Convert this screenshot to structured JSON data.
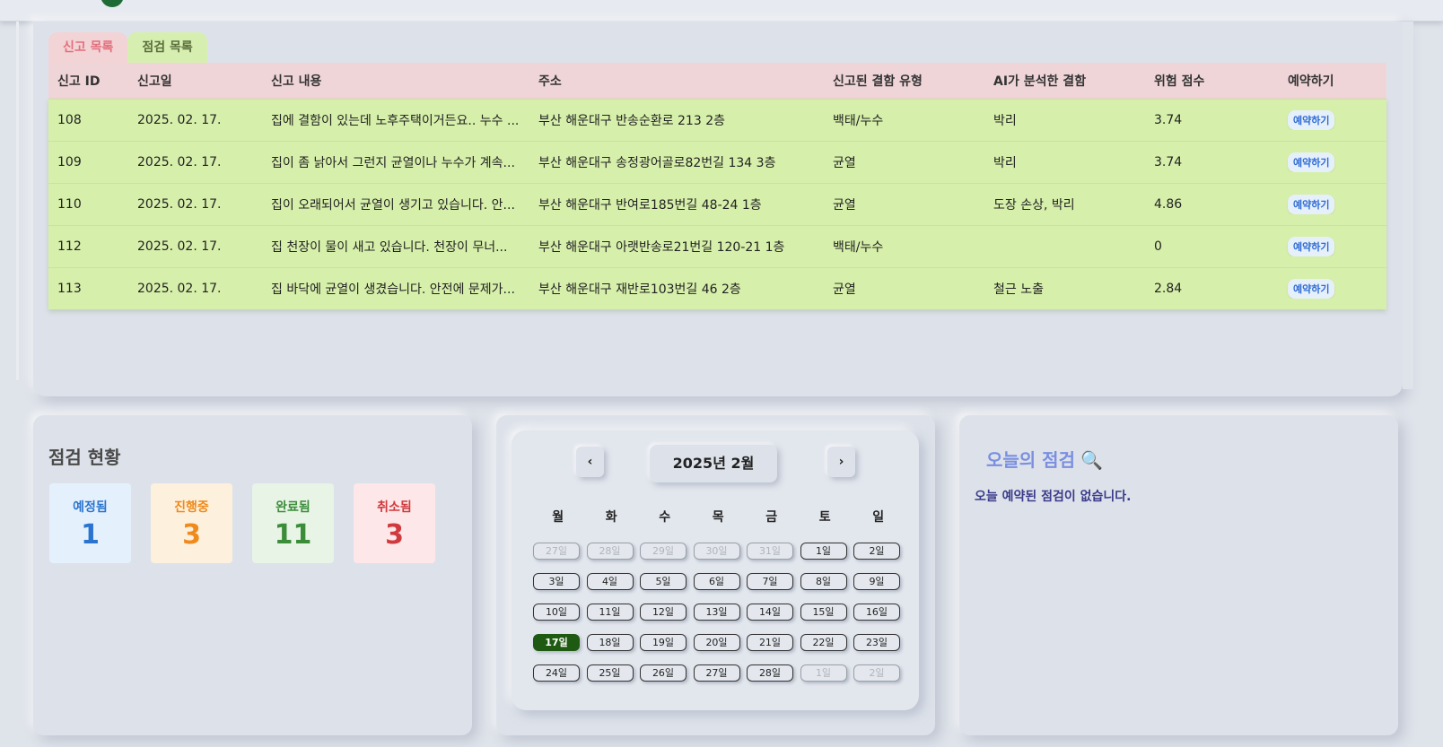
{
  "tabs": {
    "report_label": "신고 목록",
    "inspect_label": "점검 목록"
  },
  "table": {
    "headers": [
      "신고 ID",
      "신고일",
      "신고 내용",
      "주소",
      "신고된 결함 유형",
      "AI가 분석한 결함",
      "위험 점수",
      "예약하기"
    ],
    "rows": [
      {
        "id": "108",
        "date": "2025. 02. 17.",
        "content": "집에 결함이 있는데 노후주택이거든요.. 누수 ...",
        "address": "부산 해운대구 반송순환로 213 2층",
        "reported_type": "백태/누수",
        "ai_defect": "박리",
        "risk": "3.74",
        "action": "예약하기"
      },
      {
        "id": "109",
        "date": "2025. 02. 17.",
        "content": "집이 좀 낡아서 그런지 균열이나 누수가 계속...",
        "address": "부산 해운대구 송정광어골로82번길 134 3층",
        "reported_type": "균열",
        "ai_defect": "박리",
        "risk": "3.74",
        "action": "예약하기"
      },
      {
        "id": "110",
        "date": "2025. 02. 17.",
        "content": "집이 오래되어서 균열이 생기고 있습니다. 안...",
        "address": "부산 해운대구 반여로185번길 48-24 1층",
        "reported_type": "균열",
        "ai_defect": "도장 손상, 박리",
        "risk": "4.86",
        "action": "예약하기"
      },
      {
        "id": "112",
        "date": "2025. 02. 17.",
        "content": "집 천장이 물이 새고 있습니다. 천장이 무너...",
        "address": "부산 해운대구 아랫반송로21번길 120-21 1층",
        "reported_type": "백태/누수",
        "ai_defect": "",
        "risk": "0",
        "action": "예약하기"
      },
      {
        "id": "113",
        "date": "2025. 02. 17.",
        "content": "집 바닥에 균열이 생겼습니다. 안전에 문제가...",
        "address": "부산 해운대구 재반로103번길 46 2층",
        "reported_type": "균열",
        "ai_defect": "철근 노출",
        "risk": "2.84",
        "action": "예약하기"
      }
    ]
  },
  "status": {
    "title": "점검 현황",
    "items": [
      {
        "label": "예정됨",
        "count": "1",
        "color": "#2a74cf"
      },
      {
        "label": "진행중",
        "count": "3",
        "color": "#ef8a1c"
      },
      {
        "label": "완료됨",
        "count": "11",
        "color": "#3c8d3a"
      },
      {
        "label": "취소됨",
        "count": "3",
        "color": "#d03a3e"
      }
    ]
  },
  "calendar": {
    "month_label": "2025년 2월",
    "prev_icon": "‹",
    "next_icon": "›",
    "weekdays": [
      "월",
      "화",
      "수",
      "목",
      "금",
      "토",
      "일"
    ],
    "days": [
      {
        "label": "27일",
        "muted": true
      },
      {
        "label": "28일",
        "muted": true
      },
      {
        "label": "29일",
        "muted": true
      },
      {
        "label": "30일",
        "muted": true
      },
      {
        "label": "31일",
        "muted": true
      },
      {
        "label": "1일"
      },
      {
        "label": "2일"
      },
      {
        "label": "3일"
      },
      {
        "label": "4일"
      },
      {
        "label": "5일"
      },
      {
        "label": "6일"
      },
      {
        "label": "7일"
      },
      {
        "label": "8일"
      },
      {
        "label": "9일"
      },
      {
        "label": "10일"
      },
      {
        "label": "11일"
      },
      {
        "label": "12일"
      },
      {
        "label": "13일"
      },
      {
        "label": "14일"
      },
      {
        "label": "15일"
      },
      {
        "label": "16일"
      },
      {
        "label": "17일",
        "today": true
      },
      {
        "label": "18일"
      },
      {
        "label": "19일"
      },
      {
        "label": "20일"
      },
      {
        "label": "21일"
      },
      {
        "label": "22일"
      },
      {
        "label": "23일"
      },
      {
        "label": "24일"
      },
      {
        "label": "25일"
      },
      {
        "label": "26일"
      },
      {
        "label": "27일"
      },
      {
        "label": "28일"
      },
      {
        "label": "1일",
        "muted": true
      },
      {
        "label": "2일",
        "muted": true
      }
    ],
    "today_color": "#1f5a12"
  },
  "today": {
    "title": "오늘의 점검",
    "icon": "🔍",
    "empty_message": "오늘 예약된 점검이 없습니다."
  }
}
